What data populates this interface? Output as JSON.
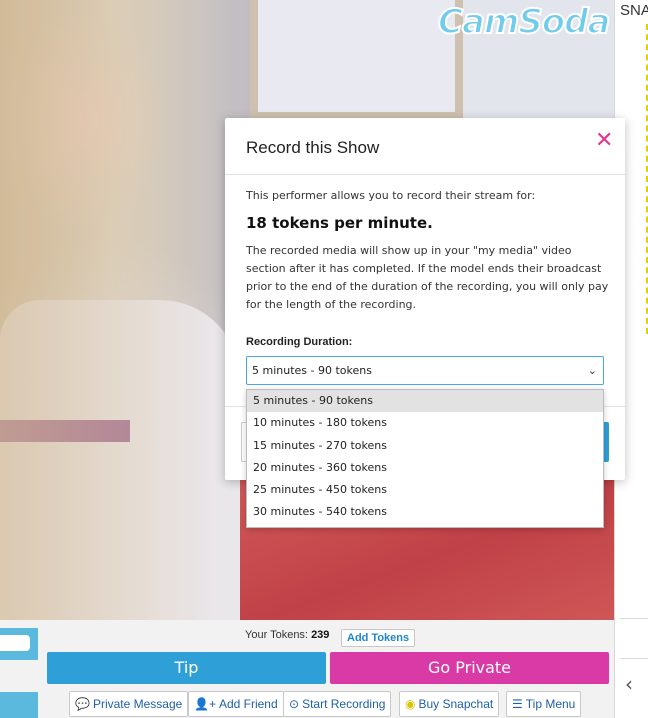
{
  "site": {
    "logo_text": "CamSoda"
  },
  "sidebar": {
    "label": "SNA"
  },
  "modal": {
    "title": "Record this Show",
    "intro": "This performer allows you to record their stream for:",
    "price": "18 tokens per minute.",
    "description": "The recorded media will show up in your \"my media\" video section after it has completed. If the model ends their broadcast prior to the end of the duration of the recording, you will only pay for the length of the recording.",
    "duration_label": "Recording Duration:",
    "duration_value": "5 minutes - 90 tokens",
    "duration_options": [
      "5 minutes - 90 tokens",
      "10 minutes - 180 tokens",
      "15 minutes - 270 tokens",
      "20 minutes - 360 tokens",
      "25 minutes - 450 tokens",
      "30 minutes - 540 tokens"
    ]
  },
  "bottom": {
    "tokens_label": "Your Tokens:",
    "tokens_value": "239",
    "add_tokens": "Add Tokens",
    "tip": "Tip",
    "go_private": "Go Private",
    "actions": {
      "private_message": "Private Message",
      "add_friend": "Add Friend",
      "start_recording": "Start Recording",
      "buy_snapchat": "Buy Snapchat",
      "tip_menu": "Tip Menu"
    }
  },
  "colors": {
    "tip": "#2f9fd7",
    "go_private": "#d93aa5",
    "close": "#e4368f",
    "focus_border": "#4aa7e6"
  }
}
